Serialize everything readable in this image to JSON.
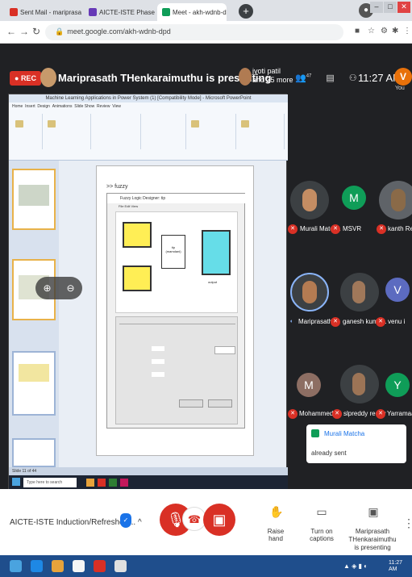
{
  "browser": {
    "tabs": [
      {
        "label": "Sent Mail - mariprasat@kum",
        "favicon_color": "#d93025"
      },
      {
        "label": "AICTE-ISTE Phase 1 attendance",
        "favicon_color": "#673ab7"
      },
      {
        "label": "Meet - akh-wdnb-dpd",
        "favicon_color": "#0f9d58"
      }
    ],
    "url": "meet.google.com/akh-wdnb-dpd",
    "new_tab": "+"
  },
  "meet": {
    "rec_label": "REC",
    "presenting_label": "Mariprasath THenkaraimuthu is presenting",
    "joined_text_line1": "jyoti patil",
    "joined_text_line2": "and 35 more",
    "participant_count": "47",
    "time": "11:27 AM",
    "you_initial": "V",
    "you_label": "You"
  },
  "shared_screen": {
    "ppt_title": "Machine Learning Applications in Power System (1) [Compatibility Mode] - Microsoft PowerPoint",
    "slide_title": ">> fuzzy",
    "fuzzy_window_title": "Fuzzy Logic Designer: tip",
    "fuzzy_menu": "File   Edit   View",
    "fis_center_line1": "tip",
    "fis_center_line2": "(mamdani)",
    "fis_output_label": "output",
    "ppt_status": "Slide 11 of 44",
    "search_placeholder": "Type here to search"
  },
  "participants": [
    {
      "name": "Murali Matcha",
      "color": "#3c4043",
      "initial": ""
    },
    {
      "name": "MSVR",
      "color": "#0f9d58",
      "initial": "M"
    },
    {
      "name": "kanth Reddy",
      "color": "#5f6368",
      "initial": ""
    },
    {
      "name": "Mariprasath ...",
      "color": "#3c4043",
      "initial": ""
    },
    {
      "name": "ganesh kuma...",
      "color": "#3c4043",
      "initial": ""
    },
    {
      "name": "venu i",
      "color": "#5c6bc0",
      "initial": "V"
    },
    {
      "name": "Mohammed ...",
      "color": "#8d6e63",
      "initial": "M"
    },
    {
      "name": "slpreddy reddy",
      "color": "#3c4043",
      "initial": ""
    },
    {
      "name": "Yarramaadha...",
      "color": "#0f9d58",
      "initial": "Y"
    }
  ],
  "chat": {
    "sender": "Murali Matcha",
    "message": "already sent"
  },
  "controls": {
    "meeting_title": "AICTE-ISTE Induction/Refresher ...",
    "raise_hand": "Raise hand",
    "captions": "Turn on captions",
    "presenting_line1": "Mariprasath THenkaraimuthu",
    "presenting_line2": "is presenting"
  },
  "os": {
    "time": "11:27 AM"
  }
}
